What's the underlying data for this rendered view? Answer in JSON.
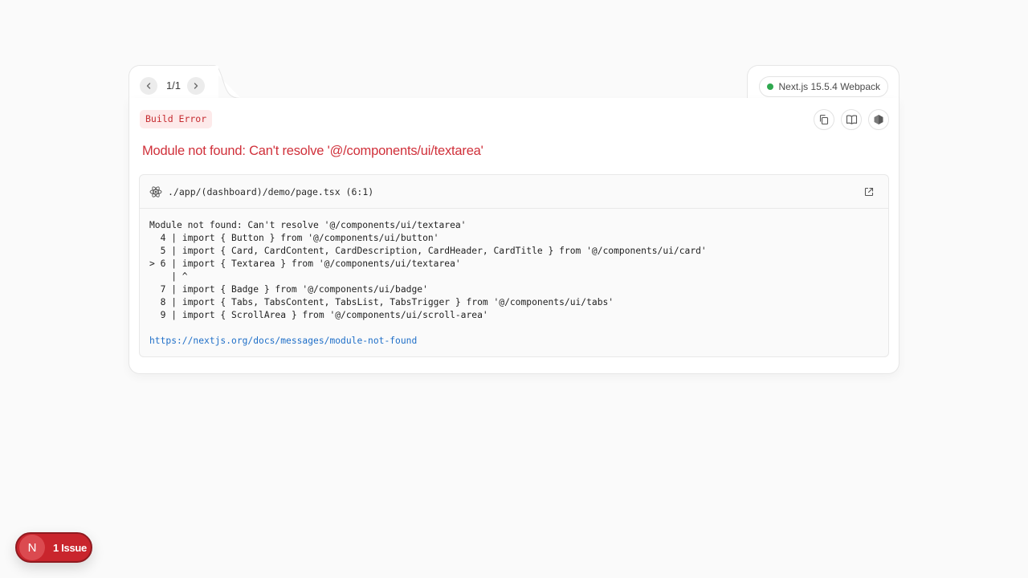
{
  "pager": {
    "count": "1/1",
    "prev_icon": "chevron-left-icon",
    "next_icon": "chevron-right-icon"
  },
  "version": {
    "label": "Next.js 15.5.4 Webpack",
    "status_color": "#2fa84f"
  },
  "error": {
    "badge": "Build Error",
    "title": "Module not found: Can't resolve '@/components/ui/textarea'"
  },
  "toolbar": {
    "copy_icon": "copy-icon",
    "docs_icon": "book-icon",
    "node_icon": "nodejs-icon"
  },
  "code": {
    "file_path": "./app/(dashboard)/demo/page.tsx (6:1)",
    "lines": [
      "Module not found: Can't resolve '@/components/ui/textarea'",
      "  4 | import { Button } from '@/components/ui/button'",
      "  5 | import { Card, CardContent, CardDescription, CardHeader, CardTitle } from '@/components/ui/card'",
      "> 6 | import { Textarea } from '@/components/ui/textarea'",
      "    | ^",
      "  7 | import { Badge } from '@/components/ui/badge'",
      "  8 | import { Tabs, TabsContent, TabsList, TabsTrigger } from '@/components/ui/tabs'",
      "  9 | import { ScrollArea } from '@/components/ui/scroll-area'"
    ],
    "link": "https://nextjs.org/docs/messages/module-not-found"
  },
  "issues": {
    "logo": "N",
    "label": "1 Issue"
  },
  "colors": {
    "error": "#d0303a",
    "badge_bg": "#fdeaea",
    "link": "#1f6fc8",
    "issue_pill": "#c9252d"
  }
}
